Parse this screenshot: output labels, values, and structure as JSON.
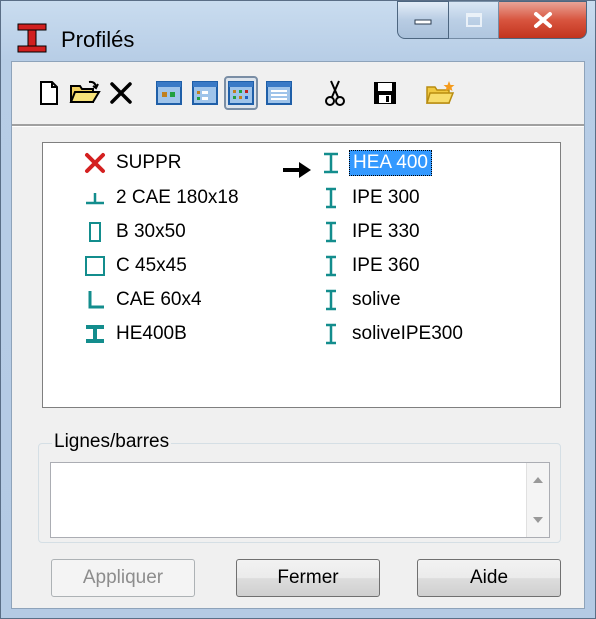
{
  "window": {
    "title": "Profilés",
    "buttons": {
      "minimize": "minimize",
      "maximize": "maximize",
      "close": "close"
    }
  },
  "toolbar": {
    "items": [
      {
        "icon": "new-document-icon"
      },
      {
        "icon": "open-folder-icon"
      },
      {
        "icon": "delete-icon"
      },
      {
        "icon": "view-large-icons-icon"
      },
      {
        "icon": "view-small-icons-icon"
      },
      {
        "icon": "view-list-icon",
        "pressed": true
      },
      {
        "icon": "view-details-icon"
      },
      {
        "icon": "cut-icon"
      },
      {
        "icon": "save-icon"
      },
      {
        "icon": "new-folder-icon"
      }
    ]
  },
  "profiles": {
    "left": [
      {
        "label": "SUPPR",
        "icon": "delete-x-icon"
      },
      {
        "label": "2 CAE 180x18",
        "icon": "double-angle-profile-icon"
      },
      {
        "label": "B 30x50",
        "icon": "rectangle-profile-icon"
      },
      {
        "label": "C 45x45",
        "icon": "square-profile-icon"
      },
      {
        "label": "CAE 60x4",
        "icon": "angle-profile-icon"
      },
      {
        "label": "HE400B",
        "icon": "h-beam-profile-icon"
      }
    ],
    "right": [
      {
        "label": "HEA 400",
        "icon": "i-beam-profile-icon",
        "selected": true
      },
      {
        "label": "IPE 300",
        "icon": "i-beam-profile-icon"
      },
      {
        "label": "IPE 330",
        "icon": "i-beam-profile-icon"
      },
      {
        "label": "IPE 360",
        "icon": "i-beam-profile-icon"
      },
      {
        "label": "solive",
        "icon": "i-beam-profile-icon"
      },
      {
        "label": "soliveIPE300",
        "icon": "i-beam-profile-icon"
      }
    ]
  },
  "lines": {
    "label": "Lignes/barres",
    "value": ""
  },
  "actions": {
    "apply": "Appliquer",
    "apply_disabled": true,
    "close": "Fermer",
    "help": "Aide"
  },
  "colors": {
    "profile_teal": "#138d8d",
    "delete_red": "#d42020",
    "selection": "#3399ff"
  }
}
